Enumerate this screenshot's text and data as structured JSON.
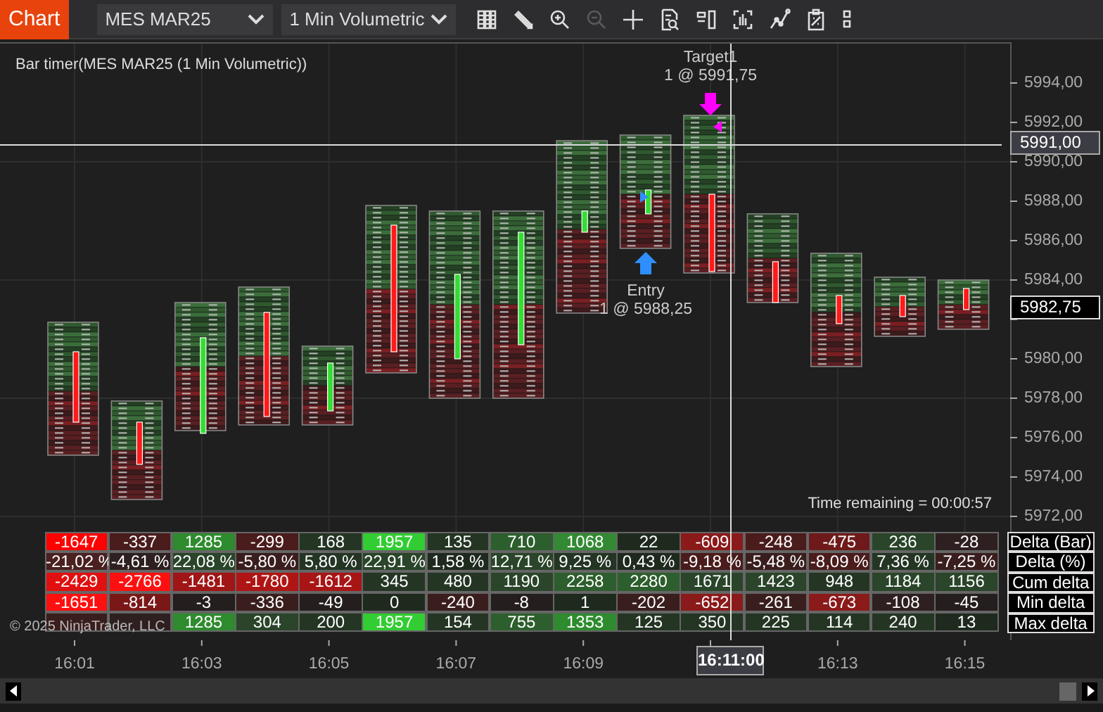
{
  "toolbar": {
    "tab": "Chart",
    "instrument": "MES MAR25",
    "interval": "1 Min Volumetric",
    "tools": [
      {
        "kind": "columns",
        "disabled": false
      },
      {
        "kind": "pencil",
        "disabled": false
      },
      {
        "kind": "zoom-in",
        "disabled": false
      },
      {
        "kind": "zoom-out",
        "disabled": true
      },
      {
        "kind": "crosshair",
        "disabled": false
      },
      {
        "kind": "doc-search",
        "disabled": false
      },
      {
        "kind": "bar-select",
        "disabled": false
      },
      {
        "kind": "volume",
        "disabled": false
      },
      {
        "kind": "line-chart",
        "disabled": false
      },
      {
        "kind": "clipboard",
        "disabled": false
      },
      {
        "kind": "grid",
        "disabled": false
      }
    ]
  },
  "chart": {
    "title": "Bar timer(MES MAR25 (1 Min Volumetric))",
    "price_ticks": [
      "5994,00",
      "5992,00",
      "5990,00",
      "5988,00",
      "5986,00",
      "5984,00",
      "5980,00",
      "5978,00",
      "5976,00",
      "5974,00",
      "5972,00"
    ],
    "crosshair_price": "5991,00",
    "last_price": "5982,75",
    "orders": [
      {
        "kind": "target",
        "label": "Target1",
        "detail": "1 @ 5991,75"
      },
      {
        "kind": "entry",
        "label": "Entry",
        "detail": "1 @ 5988,25"
      }
    ],
    "time_remaining": "Time remaining = 00:00:57",
    "copyright": "© 2025 NinjaTrader, LLC"
  },
  "table": {
    "rows": [
      {
        "label": "Delta (Bar)",
        "cells": [
          {
            "text": "-1647",
            "color": "#ff0000"
          },
          {
            "text": "-337",
            "color": "#4a1c1c"
          },
          {
            "text": "1285",
            "color": "#2e8b2e"
          },
          {
            "text": "-299",
            "color": "#4a1c1c"
          },
          {
            "text": "168",
            "color": "#243524"
          },
          {
            "text": "1957",
            "color": "#32cd32"
          },
          {
            "text": "135",
            "color": "#243524"
          },
          {
            "text": "710",
            "color": "#2d5e2d"
          },
          {
            "text": "1068",
            "color": "#338a33"
          },
          {
            "text": "22",
            "color": "#1f2a1f"
          },
          {
            "text": "-609",
            "color": "#8b1a1a"
          },
          {
            "text": "-248",
            "color": "#4a1c1c"
          },
          {
            "text": "-475",
            "color": "#6e1a1a"
          },
          {
            "text": "236",
            "color": "#2a452a"
          },
          {
            "text": "-28",
            "color": "#2e2020"
          }
        ]
      },
      {
        "label": "Delta (%)",
        "cells": [
          {
            "text": "-21,02 %",
            "color": "#4a2020"
          },
          {
            "text": "-4,61 %",
            "color": "#2e2020"
          },
          {
            "text": "22,08 %",
            "color": "#2a452a"
          },
          {
            "text": "-5,80 %",
            "color": "#3a1e1e"
          },
          {
            "text": "5,80 %",
            "color": "#243524"
          },
          {
            "text": "22,91 %",
            "color": "#2a452a"
          },
          {
            "text": "1,58 %",
            "color": "#1f2a1f"
          },
          {
            "text": "12,71 %",
            "color": "#2a452a"
          },
          {
            "text": "9,25 %",
            "color": "#243524"
          },
          {
            "text": "0,43 %",
            "color": "#1f2a1f"
          },
          {
            "text": "-9,18 %",
            "color": "#4a1c1c"
          },
          {
            "text": "-5,48 %",
            "color": "#3a1e1e"
          },
          {
            "text": "-8,09 %",
            "color": "#4a1c1c"
          },
          {
            "text": "7,36 %",
            "color": "#243524"
          },
          {
            "text": "-7,25 %",
            "color": "#3a1e1e"
          }
        ]
      },
      {
        "label": "Cum delta",
        "cells": [
          {
            "text": "-2429",
            "color": "#e01010"
          },
          {
            "text": "-2766",
            "color": "#ff1010"
          },
          {
            "text": "-1481",
            "color": "#a01515"
          },
          {
            "text": "-1780",
            "color": "#b01515"
          },
          {
            "text": "-1612",
            "color": "#a81515"
          },
          {
            "text": "345",
            "color": "#243524"
          },
          {
            "text": "480",
            "color": "#243524"
          },
          {
            "text": "1190",
            "color": "#2a452a"
          },
          {
            "text": "2258",
            "color": "#2d5e2d"
          },
          {
            "text": "2280",
            "color": "#2d5e2d"
          },
          {
            "text": "1671",
            "color": "#2a452a"
          },
          {
            "text": "1423",
            "color": "#2a452a"
          },
          {
            "text": "948",
            "color": "#243524"
          },
          {
            "text": "1184",
            "color": "#2a452a"
          },
          {
            "text": "1156",
            "color": "#2a452a"
          }
        ]
      },
      {
        "label": "Min delta",
        "cells": [
          {
            "text": "-1651",
            "color": "#ff1010"
          },
          {
            "text": "-814",
            "color": "#7a1818"
          },
          {
            "text": "-3",
            "color": "#241e1e"
          },
          {
            "text": "-336",
            "color": "#3a1e1e"
          },
          {
            "text": "-49",
            "color": "#241e1e"
          },
          {
            "text": "0",
            "color": "#1f2a1f"
          },
          {
            "text": "-240",
            "color": "#3a1e1e"
          },
          {
            "text": "-8",
            "color": "#241e1e"
          },
          {
            "text": "1",
            "color": "#1f2a1f"
          },
          {
            "text": "-202",
            "color": "#3a1e1e"
          },
          {
            "text": "-652",
            "color": "#8b1a1a"
          },
          {
            "text": "-261",
            "color": "#3a1e1e"
          },
          {
            "text": "-673",
            "color": "#8b1a1a"
          },
          {
            "text": "-108",
            "color": "#2e2020"
          },
          {
            "text": "-45",
            "color": "#241e1e"
          }
        ]
      },
      {
        "label": "Max delta",
        "cells": [
          {
            "color": "#3a1e1e"
          },
          {
            "color": "#2e2020"
          },
          {
            "text": "1285",
            "color": "#2e8b2e"
          },
          {
            "text": "304",
            "color": "#2a452a"
          },
          {
            "text": "200",
            "color": "#243524"
          },
          {
            "text": "1957",
            "color": "#32cd32"
          },
          {
            "text": "154",
            "color": "#243524"
          },
          {
            "text": "755",
            "color": "#2d5e2d"
          },
          {
            "text": "1353",
            "color": "#2e8b2e"
          },
          {
            "text": "125",
            "color": "#243524"
          },
          {
            "text": "350",
            "color": "#243524"
          },
          {
            "text": "225",
            "color": "#243524"
          },
          {
            "text": "114",
            "color": "#243524"
          },
          {
            "text": "240",
            "color": "#243524"
          },
          {
            "text": "13",
            "color": "#1f2a1f"
          }
        ]
      }
    ]
  },
  "time_axis": {
    "ticks": [
      "16:01",
      "16:03",
      "16:05",
      "16:07",
      "16:09",
      "16:13",
      "16:15"
    ],
    "crosshair_time": "16:11:00"
  }
}
